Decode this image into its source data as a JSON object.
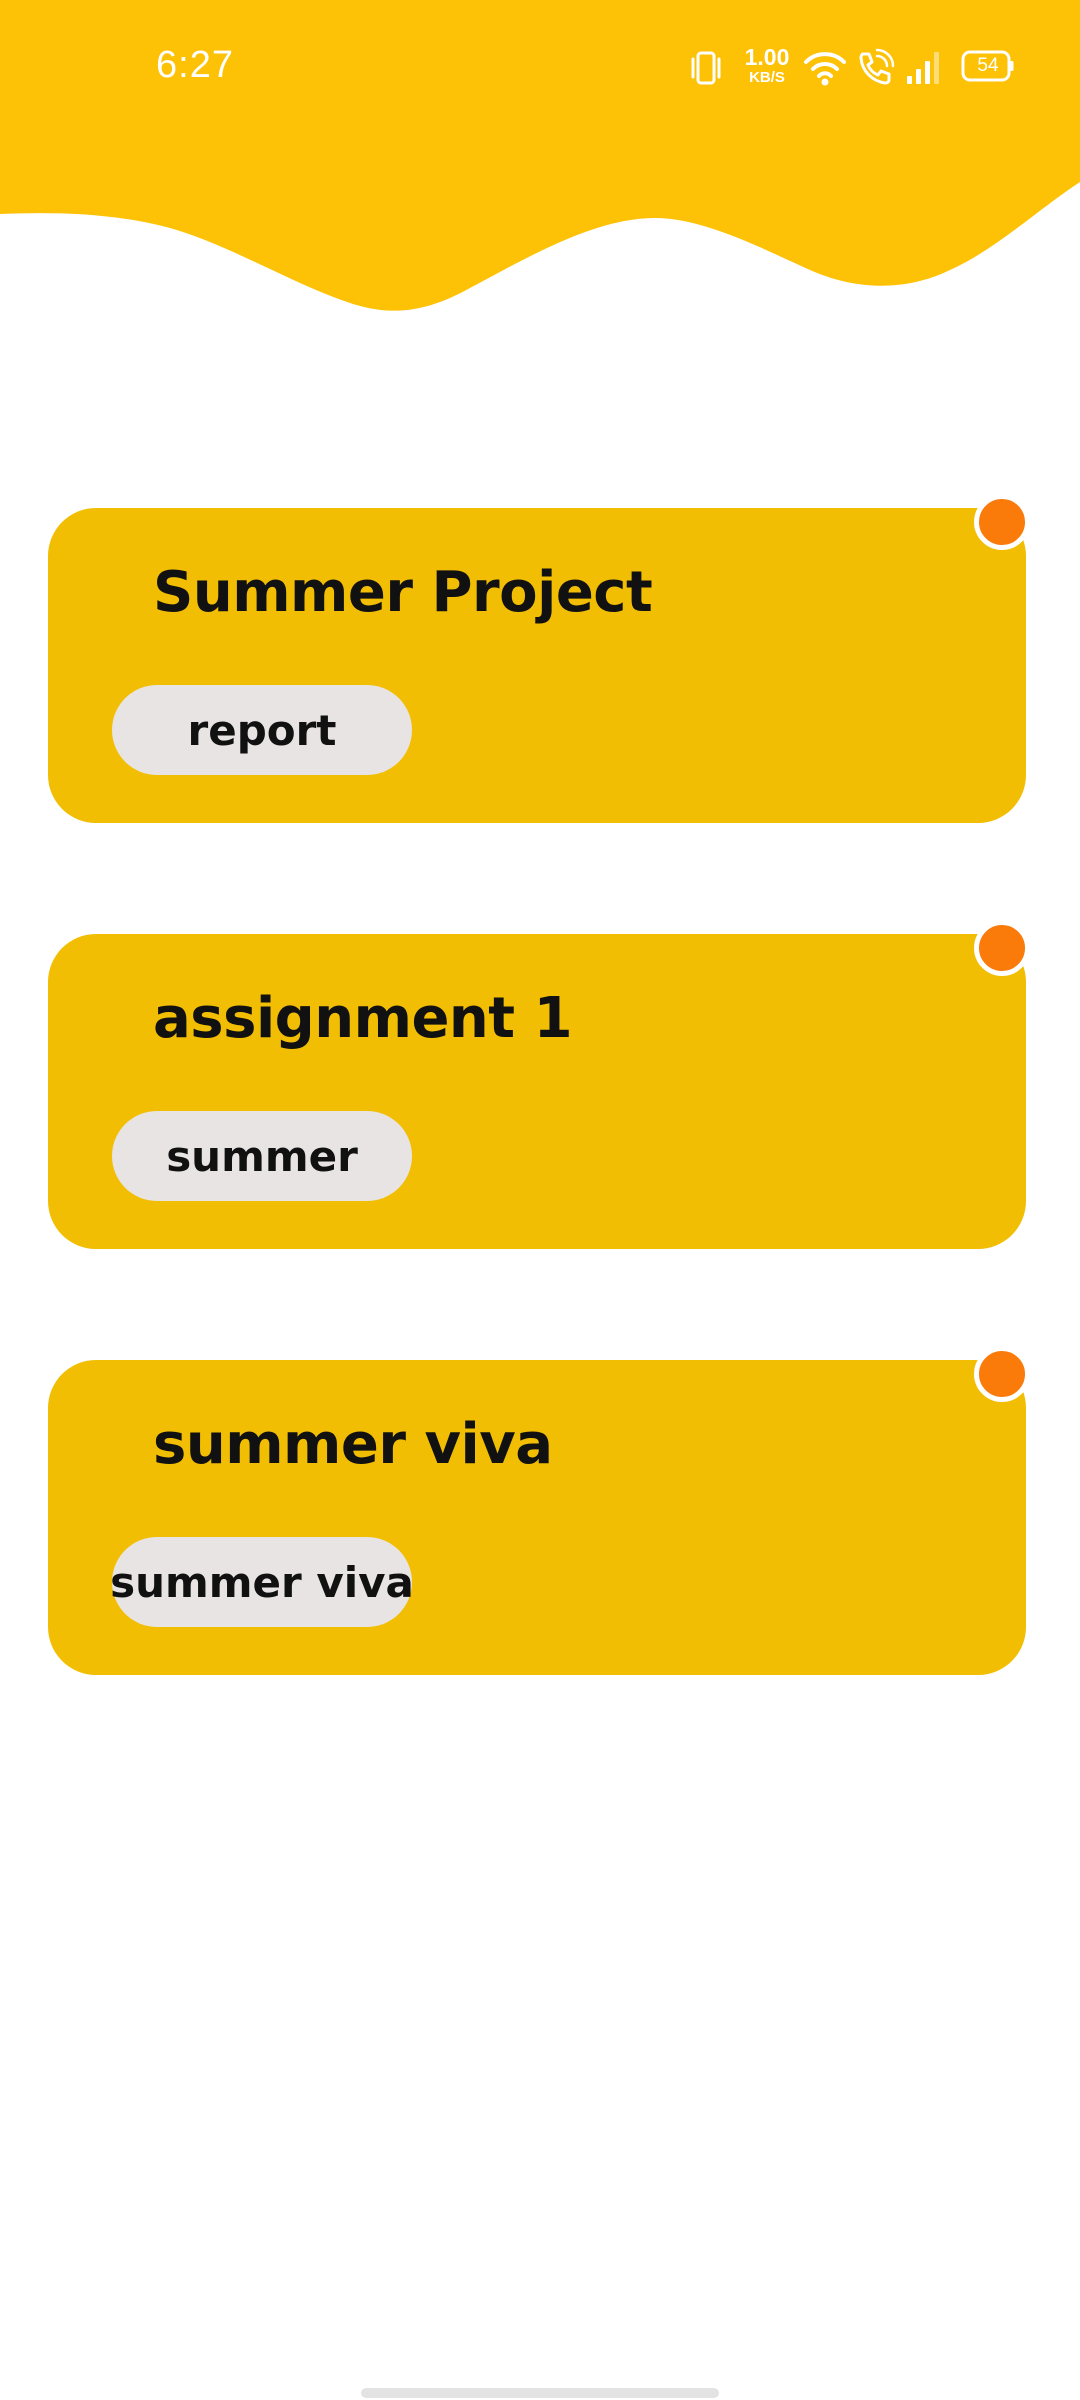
{
  "colors": {
    "header": "#FDC106",
    "card": "#F2BE03",
    "tag": "#E8E4E4",
    "status_dot": "#FA7A0A",
    "text": "#111111"
  },
  "status_bar": {
    "time": "6:27",
    "net_speed_value": "1.00",
    "net_speed_unit": "KB/S",
    "battery": "54",
    "icons": [
      "vibrate-icon",
      "wifi-icon",
      "wifi-calling-icon",
      "signal-icon",
      "battery-icon"
    ]
  },
  "tasks": [
    {
      "title": "Summer Project",
      "tag": "report"
    },
    {
      "title": "assignment 1",
      "tag": "summer"
    },
    {
      "title": "summer viva",
      "tag": "summer viva"
    }
  ]
}
